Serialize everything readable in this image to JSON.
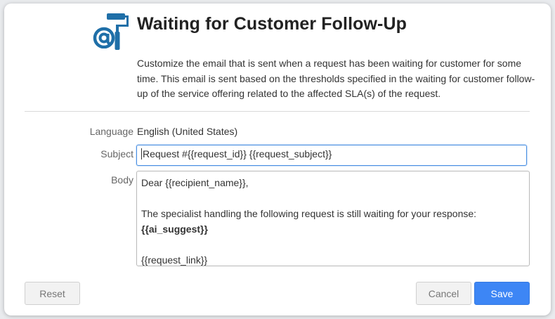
{
  "header": {
    "title": "Waiting for Customer Follow-Up",
    "description": "Customize the email that is sent when a request has been waiting for customer for some time. This email is sent based on the thresholds specified in the waiting for customer follow-up of the service offering related to the affected SLA(s) of the request.",
    "icon": "email-template-roller-icon"
  },
  "form": {
    "language_label": "Language",
    "language_value": "English (United States)",
    "subject_label": "Subject",
    "subject_value": "Request #{{request_id}} {{request_subject}}",
    "body_label": "Body",
    "body_lines": [
      "Dear {{recipient_name}},",
      "",
      "The specialist handling the following request is still waiting for your response:",
      "{{ai_suggest}}",
      "",
      "{{request_link}}"
    ]
  },
  "buttons": {
    "reset": "Reset",
    "cancel": "Cancel",
    "save": "Save"
  },
  "colors": {
    "accent": "#3d86f5",
    "logo": "#1f6fa8"
  }
}
